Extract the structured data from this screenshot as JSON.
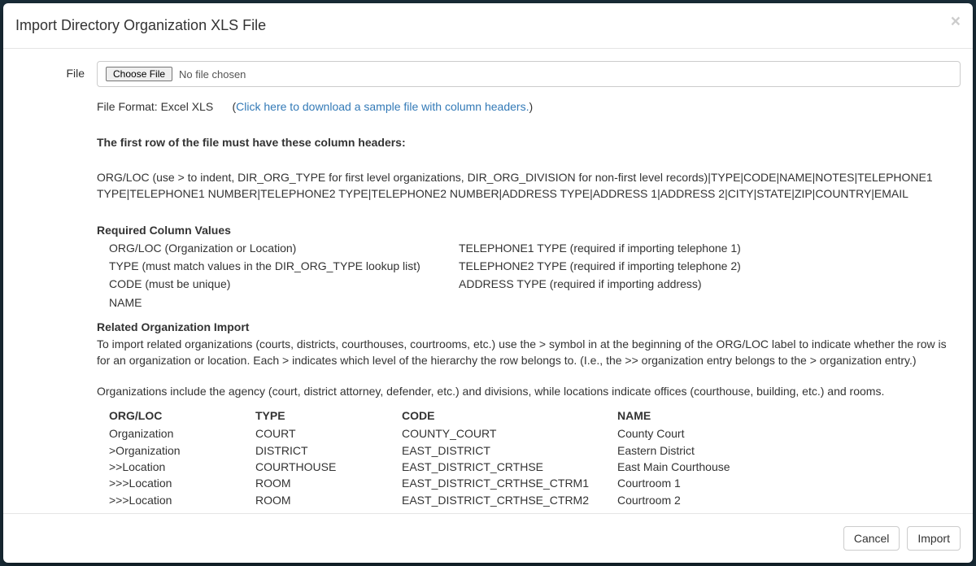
{
  "modal": {
    "title": "Import Directory Organization XLS File",
    "close_symbol": "×"
  },
  "form": {
    "file_label": "File",
    "choose_file_btn": "Choose File",
    "no_file_text": "No file chosen"
  },
  "info": {
    "file_format_prefix": "File Format: Excel XLS",
    "open_paren": "(",
    "sample_link_text": "Click here to download a sample file with column headers.",
    "close_paren": ")",
    "header_requirement": "The first row of the file must have these column headers:",
    "column_headers_line": "ORG/LOC (use > to indent, DIR_ORG_TYPE for first level organizations, DIR_ORG_DIVISION for non-first level records)|TYPE|CODE|NAME|NOTES|TELEPHONE1 TYPE|TELEPHONE1 NUMBER|TELEPHONE2 TYPE|TELEPHONE2 NUMBER|ADDRESS TYPE|ADDRESS 1|ADDRESS 2|CITY|STATE|ZIP|COUNTRY|EMAIL",
    "required_heading": "Required Column Values",
    "required_left": [
      "ORG/LOC (Organization or Location)",
      "TYPE (must match values in the DIR_ORG_TYPE lookup list)",
      "CODE (must be unique)",
      "NAME"
    ],
    "required_right": [
      "TELEPHONE1 TYPE (required if importing telephone 1)",
      "TELEPHONE2 TYPE (required if importing telephone 2)",
      "ADDRESS TYPE (required if importing address)"
    ],
    "related_heading": "Related Organization Import",
    "related_para1": "To import related organizations (courts, districts, courthouses, courtrooms, etc.) use the > symbol in at the beginning of the ORG/LOC label to indicate whether the row is for an organization or location. Each > indicates which level of the hierarchy the row belongs to. (I.e., the >> organization entry belongs to the > organization entry.)",
    "related_para2": "Organizations include the agency (court, district attorney, defender, etc.) and divisions, while locations indicate offices (courthouse, building, etc.) and rooms."
  },
  "example": {
    "headers": [
      "ORG/LOC",
      "TYPE",
      "CODE",
      "NAME"
    ],
    "rows": [
      {
        "orgloc": "Organization",
        "type": "COURT",
        "code": "COUNTY_COURT",
        "name": "County Court"
      },
      {
        "orgloc": ">Organization",
        "type": "DISTRICT",
        "code": "EAST_DISTRICT",
        "name": "Eastern District"
      },
      {
        "orgloc": ">>Location",
        "type": "COURTHOUSE",
        "code": "EAST_DISTRICT_CRTHSE",
        "name": "East Main Courthouse"
      },
      {
        "orgloc": ">>>Location",
        "type": "ROOM",
        "code": "EAST_DISTRICT_CRTHSE_CTRM1",
        "name": "Courtroom 1"
      },
      {
        "orgloc": ">>>Location",
        "type": "ROOM",
        "code": "EAST_DISTRICT_CRTHSE_CTRM2",
        "name": "Courtroom 2"
      }
    ]
  },
  "footer": {
    "cancel": "Cancel",
    "import": "Import"
  }
}
